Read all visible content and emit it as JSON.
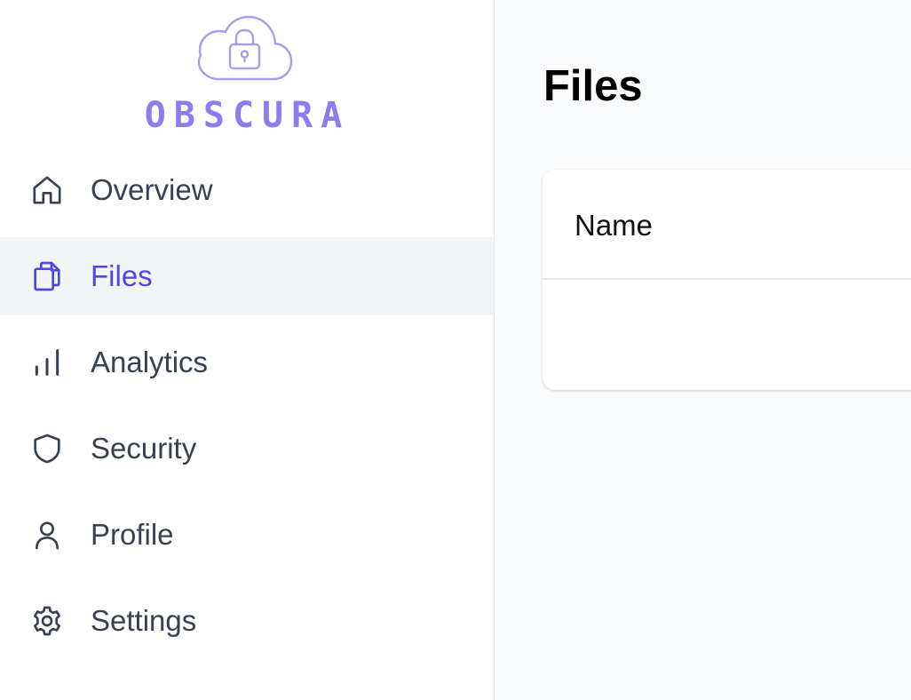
{
  "brand": {
    "name": "OBSCURA",
    "color": "#8b7cf0"
  },
  "sidebar": {
    "items": [
      {
        "label": "Overview",
        "icon": "home-icon",
        "active": false
      },
      {
        "label": "Files",
        "icon": "files-icon",
        "active": true
      },
      {
        "label": "Analytics",
        "icon": "bar-chart-icon",
        "active": false
      },
      {
        "label": "Security",
        "icon": "shield-icon",
        "active": false
      },
      {
        "label": "Profile",
        "icon": "user-icon",
        "active": false
      },
      {
        "label": "Settings",
        "icon": "gear-icon",
        "active": false
      }
    ]
  },
  "main": {
    "title": "Files",
    "table": {
      "columns": [
        "Name"
      ],
      "rows": []
    }
  },
  "colors": {
    "accent": "#4f46e5",
    "text": "#374151",
    "active_bg": "#f3f4f6",
    "main_bg": "#f9fafb"
  }
}
